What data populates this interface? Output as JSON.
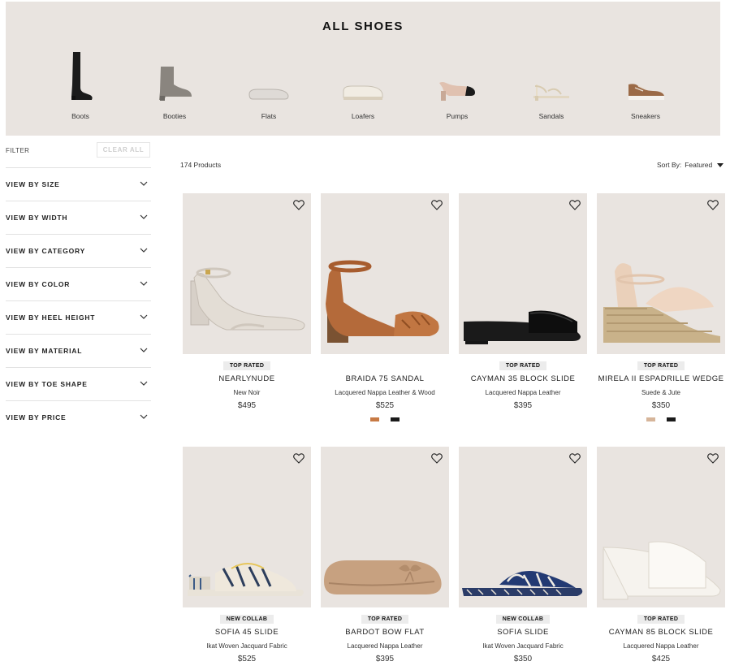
{
  "hero": {
    "title": "ALL SHOES",
    "categories": [
      {
        "label": "Boots",
        "icon": "boot-icon"
      },
      {
        "label": "Booties",
        "icon": "bootie-icon"
      },
      {
        "label": "Flats",
        "icon": "flat-icon"
      },
      {
        "label": "Loafers",
        "icon": "loafer-icon"
      },
      {
        "label": "Pumps",
        "icon": "pump-icon"
      },
      {
        "label": "Sandals",
        "icon": "sandal-icon"
      },
      {
        "label": "Sneakers",
        "icon": "sneaker-icon"
      }
    ]
  },
  "filters": {
    "heading": "FILTER",
    "clear_label": "CLEAR ALL",
    "facets": [
      "VIEW BY SIZE",
      "VIEW BY WIDTH",
      "VIEW BY CATEGORY",
      "VIEW BY COLOR",
      "VIEW BY HEEL HEIGHT",
      "VIEW BY MATERIAL",
      "VIEW BY TOE SHAPE",
      "VIEW BY PRICE"
    ]
  },
  "toolbar": {
    "count": "174 Products",
    "sort_label": "Sort By:",
    "sort_value": "Featured"
  },
  "products": [
    {
      "badge": "TOP RATED",
      "name": "NEARLYNUDE",
      "material": "New Noir",
      "price": "$495",
      "swatches": []
    },
    {
      "badge": "",
      "name": "BRAIDA 75 SANDAL",
      "material": "Lacquered Nappa Leather & Wood",
      "price": "$525",
      "swatches": [
        "#c77a45",
        "#1a1a1a"
      ]
    },
    {
      "badge": "TOP RATED",
      "name": "CAYMAN 35 BLOCK SLIDE",
      "material": "Lacquered Nappa Leather",
      "price": "$395",
      "swatches": []
    },
    {
      "badge": "TOP RATED",
      "name": "MIRELA II ESPADRILLE WEDGE",
      "material": "Suede & Jute",
      "price": "$350",
      "swatches": [
        "#d6b59a",
        "#1a1a1a"
      ]
    },
    {
      "badge": "NEW COLLAB",
      "name": "SOFIA 45 SLIDE",
      "material": "Ikat Woven Jacquard Fabric",
      "price": "$525",
      "swatches": []
    },
    {
      "badge": "TOP RATED",
      "name": "BARDOT BOW FLAT",
      "material": "Lacquered Nappa Leather",
      "price": "$395",
      "swatches": []
    },
    {
      "badge": "NEW COLLAB",
      "name": "SOFIA SLIDE",
      "material": "Ikat Woven Jacquard Fabric",
      "price": "$350",
      "swatches": []
    },
    {
      "badge": "TOP RATED",
      "name": "CAYMAN 85 BLOCK SLIDE",
      "material": "Lacquered Nappa Leather",
      "price": "$425",
      "swatches": []
    }
  ],
  "colors": {
    "panel_bg": "#e9e4e0",
    "badge_bg": "#ececec",
    "text": "#222222"
  }
}
